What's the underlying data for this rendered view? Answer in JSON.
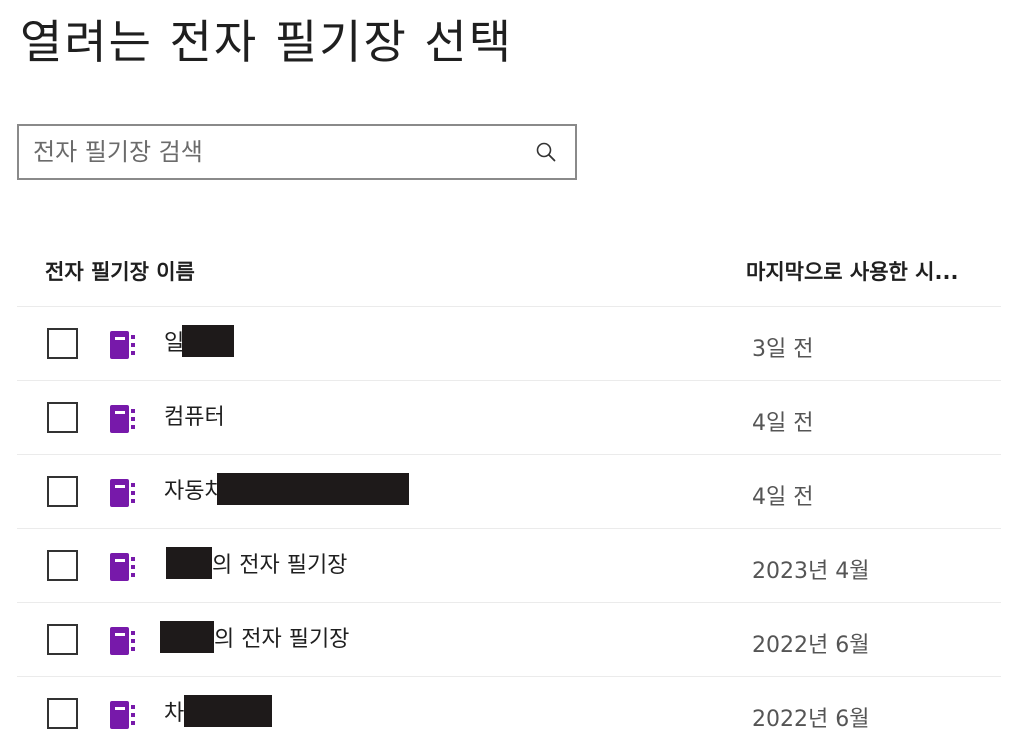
{
  "dialog": {
    "title": "열려는 전자 필기장 선택"
  },
  "search": {
    "placeholder": "전자 필기장 검색",
    "value": "",
    "icon": "search-icon"
  },
  "table": {
    "columns": {
      "name": "전자 필기장 이름",
      "last_used": "마지막으로 사용한 시..."
    },
    "rows": [
      {
        "name_before": "일",
        "name_after": "",
        "date": "3일 전",
        "checked": false,
        "icon": "onenote-notebook-icon"
      },
      {
        "name_before": "컴퓨터",
        "name_after": "",
        "date": "4일 전",
        "checked": false,
        "icon": "onenote-notebook-icon"
      },
      {
        "name_before": "자동차",
        "name_after": "",
        "date": "4일 전",
        "checked": false,
        "icon": "onenote-notebook-icon"
      },
      {
        "name_before": "",
        "name_after": "의 전자 필기장",
        "date": "2023년 4월",
        "checked": false,
        "icon": "onenote-notebook-icon"
      },
      {
        "name_before": "",
        "name_after": "의 전자 필기장",
        "date": "2022년 6월",
        "checked": false,
        "icon": "onenote-notebook-icon"
      },
      {
        "name_before": "차",
        "name_after": "",
        "date": "2022년 6월",
        "checked": false,
        "icon": "onenote-notebook-icon"
      }
    ]
  },
  "colors": {
    "notebook_icon": "#7719aa",
    "border": "#8a8a8a",
    "divider": "#ebebeb",
    "redaction": "#1e1a1a"
  }
}
